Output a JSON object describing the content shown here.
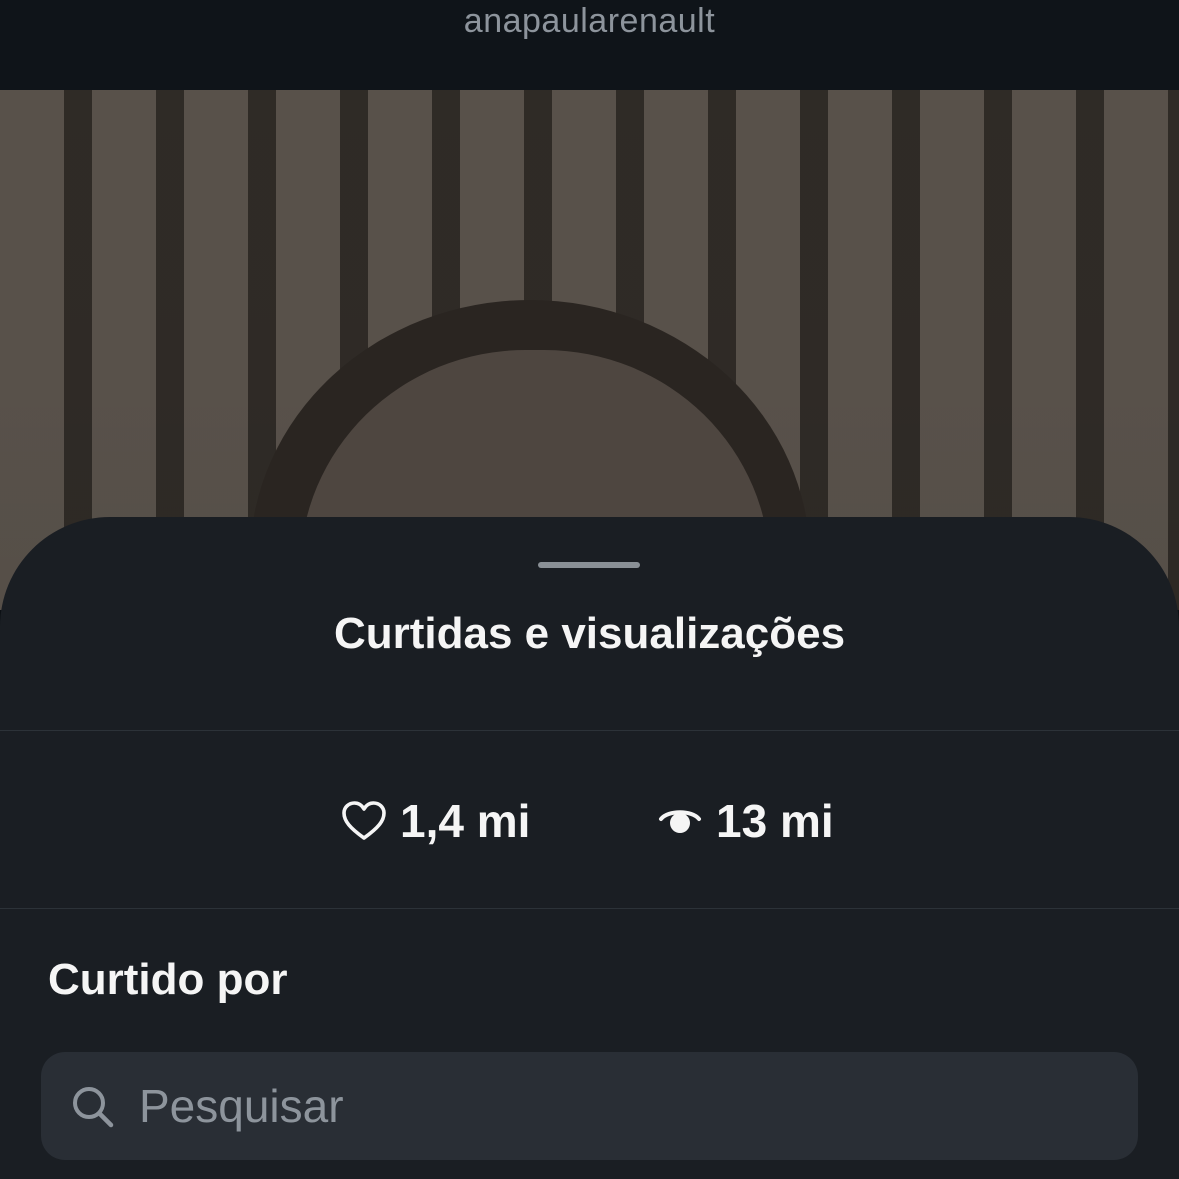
{
  "header": {
    "username": "anapaularenault"
  },
  "sheet": {
    "title": "Curtidas e visualizações",
    "stats": {
      "likes": "1,4 mi",
      "views": "13 mi"
    },
    "liked_by_title": "Curtido por",
    "search": {
      "placeholder": "Pesquisar",
      "value": ""
    }
  },
  "icons": {
    "back": "chevron-left-icon",
    "likes": "heart-icon",
    "views": "eye-icon",
    "search": "search-icon"
  },
  "colors": {
    "sheet_background": "#1a1e23",
    "search_background": "#292e35",
    "text_primary": "#f5f5f5",
    "text_secondary": "#8d949c"
  }
}
